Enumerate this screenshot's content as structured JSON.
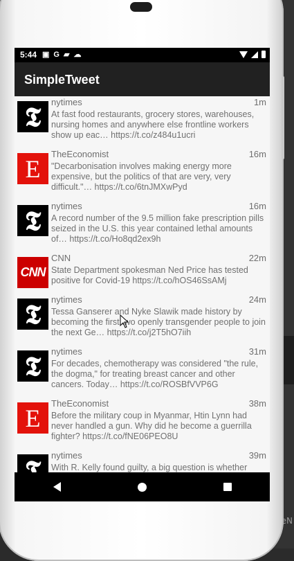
{
  "backdrop": {
    "edge_text": "eN"
  },
  "status_bar": {
    "time": "5:44",
    "left_icons": [
      "message-icon",
      "google-icon",
      "sd-card-icon",
      "cloud-icon"
    ],
    "right_icons": [
      "wifi-icon",
      "signal-icon",
      "battery-icon"
    ]
  },
  "app_bar": {
    "title": "SimpleTweet"
  },
  "tweets": [
    {
      "avatar": "nytimes-logo",
      "avatar_glyph": "𝕿",
      "handle": "nytimes",
      "time": "1m",
      "text": "At fast food restaurants, grocery stores, warehouses, nursing homes and anywhere else frontline workers show up eac… https://t.co/z484u1ucri"
    },
    {
      "avatar": "economist-logo",
      "avatar_glyph": "E",
      "handle": "TheEconomist",
      "time": "16m",
      "text": "\"Decarbonisation involves making energy more expensive, but the politics of that are very, very difficult.\"… https://t.co/6tnJMXwPyd"
    },
    {
      "avatar": "nytimes-logo",
      "avatar_glyph": "𝕿",
      "handle": "nytimes",
      "time": "16m",
      "text": "A record number of the 9.5 million fake prescription pills seized in the U.S. this year contained lethal amounts of… https://t.co/Ho8qd2ex9h"
    },
    {
      "avatar": "cnn-logo",
      "avatar_glyph": "CNN",
      "handle": "CNN",
      "time": "22m",
      "text": "State Department spokesman Ned Price has tested positive for Covid-19 https://t.co/hOS46SsAMj"
    },
    {
      "avatar": "nytimes-logo",
      "avatar_glyph": "𝕿",
      "handle": "nytimes",
      "time": "24m",
      "text": "Tessa Ganserer and Nyke Slawik made history by becoming the first two openly transgender people to join the next Ge… https://t.co/j2T5hO7iih"
    },
    {
      "avatar": "nytimes-logo",
      "avatar_glyph": "𝕿",
      "handle": "nytimes",
      "time": "31m",
      "text": "For decades, chemotherapy was considered \"the rule, the dogma,\" for treating breast cancer and other cancers. Today… https://t.co/ROSBfVVP6G"
    },
    {
      "avatar": "economist-logo",
      "avatar_glyph": "E",
      "handle": "TheEconomist",
      "time": "38m",
      "text": "Before the military coup in Myanmar, Htin Lynn had never handled a gun. Why did he become a guerrilla fighter?  https://t.co/fNE06PEO8U"
    },
    {
      "avatar": "nytimes-logo",
      "avatar_glyph": "𝕿",
      "handle": "nytimes",
      "time": "39m",
      "text": "With R. Kelly found guilty, a big question is whether"
    }
  ],
  "nav_bar": {
    "buttons": [
      "back-icon",
      "home-icon",
      "recents-icon"
    ]
  },
  "colors": {
    "app_bar": "#212121",
    "timeline_bg": "#f6f6f6",
    "text": "#707070",
    "economist_red": "#e3120b",
    "cnn_red": "#cc0000"
  }
}
